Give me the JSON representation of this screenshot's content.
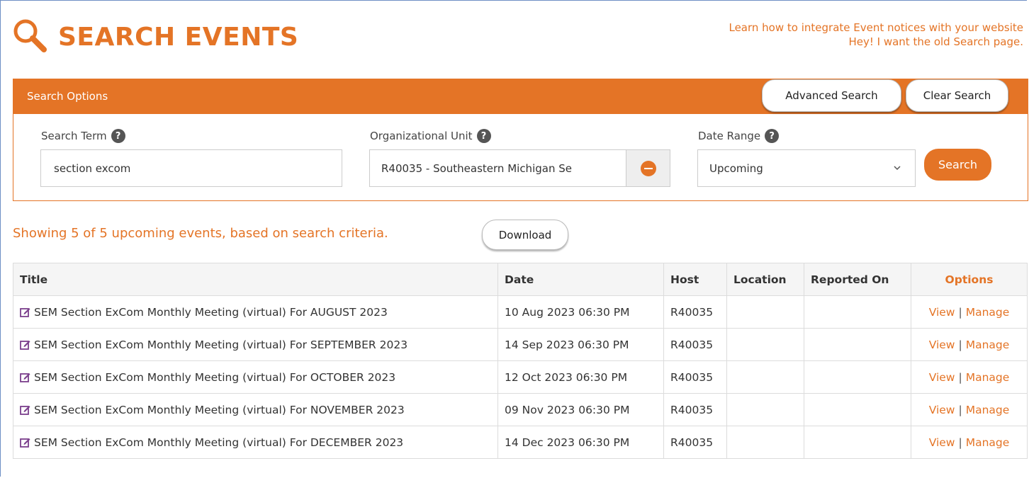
{
  "header": {
    "title": "SEARCH EVENTS",
    "integrate_link": "Learn how to integrate Event notices with your website",
    "old_search_link": "Hey! I want the old Search page."
  },
  "search_options": {
    "panel_title": "Search Options",
    "advanced_search_label": "Advanced Search",
    "clear_search_label": "Clear Search",
    "search_term_label": "Search Term",
    "search_term_value": "section excom",
    "org_unit_label": "Organizational Unit",
    "org_unit_value": "R40035 - Southeastern Michigan Se",
    "date_range_label": "Date Range",
    "date_range_value": "Upcoming",
    "search_button_label": "Search",
    "help_glyph": "?"
  },
  "results": {
    "summary": "Showing 5 of 5 upcoming events, based on search criteria.",
    "download_label": "Download",
    "columns": [
      "Title",
      "Date",
      "Host",
      "Location",
      "Reported On",
      "Options"
    ],
    "rows": [
      {
        "title": "SEM Section ExCom Monthly Meeting (virtual) For AUGUST 2023",
        "date": "10 Aug 2023 06:30 PM",
        "host": "R40035",
        "location": "",
        "reported_on": "",
        "view": "View",
        "manage": "Manage"
      },
      {
        "title": "SEM Section ExCom Monthly Meeting (virtual) For SEPTEMBER 2023",
        "date": "14 Sep 2023 06:30 PM",
        "host": "R40035",
        "location": "",
        "reported_on": "",
        "view": "View",
        "manage": "Manage"
      },
      {
        "title": "SEM Section ExCom Monthly Meeting (virtual) For OCTOBER 2023",
        "date": "12 Oct 2023 06:30 PM",
        "host": "R40035",
        "location": "",
        "reported_on": "",
        "view": "View",
        "manage": "Manage"
      },
      {
        "title": "SEM Section ExCom Monthly Meeting (virtual) For NOVEMBER 2023",
        "date": "09 Nov 2023 06:30 PM",
        "host": "R40035",
        "location": "",
        "reported_on": "",
        "view": "View",
        "manage": "Manage"
      },
      {
        "title": "SEM Section ExCom Monthly Meeting (virtual) For DECEMBER 2023",
        "date": "14 Dec 2023 06:30 PM",
        "host": "R40035",
        "location": "",
        "reported_on": "",
        "view": "View",
        "manage": "Manage"
      }
    ],
    "separator": "|"
  },
  "colors": {
    "accent": "#e47426",
    "edit_icon": "#7b3f8c"
  },
  "icons": {
    "header": "search-icon",
    "row": "edit-icon",
    "org_remove": "minus-circle-icon",
    "select": "chevron-down-icon",
    "help": "help-icon"
  }
}
